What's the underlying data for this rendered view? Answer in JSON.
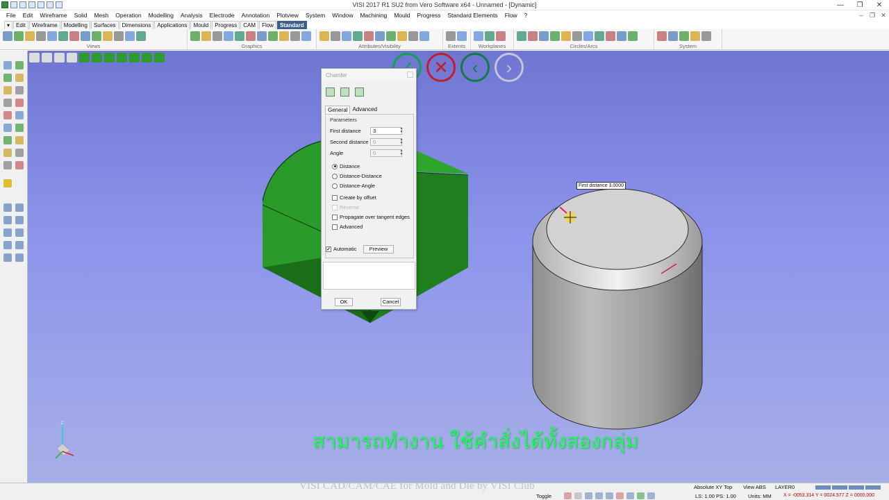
{
  "window": {
    "title": "VISI 2017 R1 SU2 from Vero Software x64 - Unnamed - [Dynamic]",
    "controls": {
      "minimize": "—",
      "restore": "❐",
      "close": "✕"
    }
  },
  "menu": [
    "File",
    "Edit",
    "Wireframe",
    "Solid",
    "Mesh",
    "Operation",
    "Modelling",
    "Analysis",
    "Electrode",
    "Annotation",
    "Plotview",
    "System",
    "Window",
    "Machining",
    "Mould",
    "Progress",
    "Standard Elements",
    "Flow",
    "?"
  ],
  "tabs": [
    {
      "label": "Edit",
      "active": false
    },
    {
      "label": "Wireframe",
      "active": false
    },
    {
      "label": "Modelling",
      "active": false
    },
    {
      "label": "Surfaces",
      "active": false
    },
    {
      "label": "Dimensions",
      "active": false
    },
    {
      "label": "Applications",
      "active": false
    },
    {
      "label": "Mould",
      "active": false
    },
    {
      "label": "Progress",
      "active": false
    },
    {
      "label": "CAM",
      "active": false
    },
    {
      "label": "Flow",
      "active": false
    },
    {
      "label": "Standard",
      "active": true
    }
  ],
  "ribbon_groups": [
    "Views",
    "Graphics",
    "Attributes/Visibility",
    "Extents",
    "Workplanes",
    "Circles/Arcs",
    "System"
  ],
  "command_buttons": {
    "ok": "✓",
    "cancel": "✕",
    "back": "‹",
    "forward": "›"
  },
  "dialog": {
    "title": "Chamfer",
    "tabs": [
      "General",
      "Advanced"
    ],
    "parameters_label": "Parameters",
    "fields": [
      {
        "label": "First distance",
        "value": "3",
        "enabled": true
      },
      {
        "label": "Second distance",
        "value": "0",
        "enabled": false
      },
      {
        "label": "Angle",
        "value": "0",
        "enabled": false
      }
    ],
    "modes": [
      {
        "label": "Distance",
        "selected": true
      },
      {
        "label": "Distance-Distance",
        "selected": false
      },
      {
        "label": "Distance-Angle",
        "selected": false
      }
    ],
    "options": [
      {
        "label": "Create by offset",
        "checked": false,
        "enabled": true
      },
      {
        "label": "Reverse",
        "checked": false,
        "enabled": false
      },
      {
        "label": "Propagate over tangent edges",
        "checked": false,
        "enabled": true
      },
      {
        "label": "Advanced",
        "checked": false,
        "enabled": true
      }
    ],
    "automatic": {
      "label": "Automatic",
      "checked": true
    },
    "preview_label": "Preview",
    "ok_label": "OK",
    "cancel_label": "Cancel"
  },
  "viewport": {
    "tooltip": "First distance 3.0000",
    "subtitle": "สามารถทำงาน ใช้คำสั่งได้ทั้งสองกลุ่ม",
    "colors": {
      "background_top": "#6e76d2",
      "background_bottom": "#a7afe8",
      "cube": "#1f8f1f",
      "cylinder": "#9a9a9a",
      "subtitle": "#15ff55"
    }
  },
  "watermark": "VISI CAD/CAM/CAE for Mold and Die by VISI Club",
  "status": {
    "view_mode": "Absolute XY Top",
    "view": "View ABS",
    "layer": "LAYER0",
    "toggle": "Toggle",
    "scale": "LS: 1.00 PS: 1.00",
    "units": "Units: MM",
    "coords": "X = -0053.314 Y = 0024.577 Z = 0000.000"
  }
}
